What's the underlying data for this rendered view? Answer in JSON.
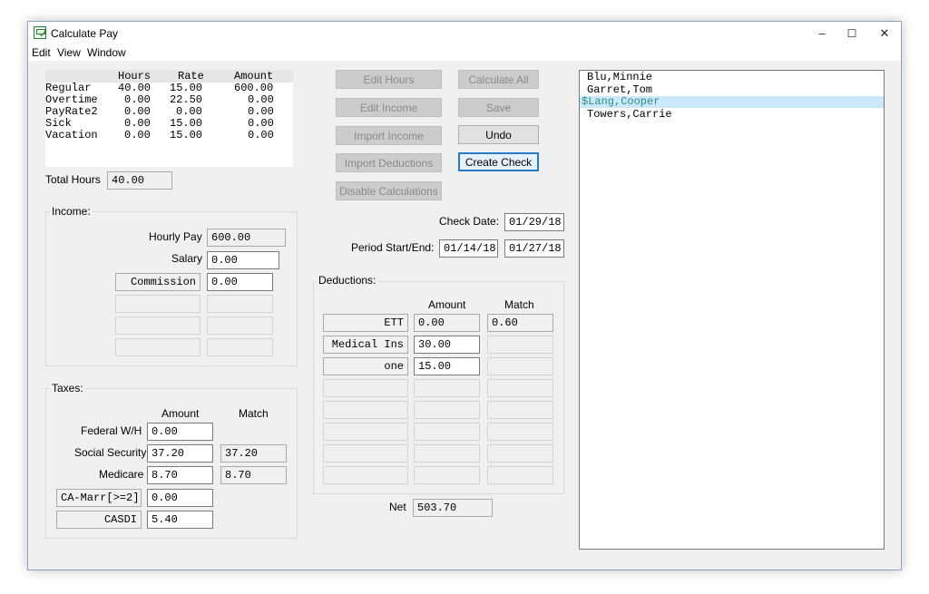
{
  "window": {
    "title": "Calculate Pay",
    "minimize": "–",
    "maximize": "☐",
    "close": "✕"
  },
  "menu": [
    "Edit",
    "View",
    "Window"
  ],
  "hours_table": {
    "headers": [
      "Hours",
      "Rate",
      "Amount"
    ],
    "rows": [
      {
        "label": "Regular",
        "hours": "40.00",
        "rate": "15.00",
        "amount": "600.00"
      },
      {
        "label": "Overtime",
        "hours": "0.00",
        "rate": "22.50",
        "amount": "0.00"
      },
      {
        "label": "PayRate2",
        "hours": "0.00",
        "rate": "0.00",
        "amount": "0.00"
      },
      {
        "label": "Sick",
        "hours": "0.00",
        "rate": "15.00",
        "amount": "0.00"
      },
      {
        "label": "Vacation",
        "hours": "0.00",
        "rate": "15.00",
        "amount": "0.00"
      }
    ]
  },
  "total_hours": {
    "label": "Total Hours",
    "value": "40.00"
  },
  "income": {
    "title": "Income:",
    "hourly_pay_label": "Hourly Pay",
    "hourly_pay_value": "600.00",
    "salary_label": "Salary",
    "salary_value": "0.00",
    "commission_label": "Commission",
    "commission_value": "0.00"
  },
  "taxes": {
    "title": "Taxes:",
    "amount_header": "Amount",
    "match_header": "Match",
    "federal_label": "Federal W/H",
    "federal_value": "0.00",
    "ss_label": "Social Security",
    "ss_value": "37.20",
    "ss_match": "37.20",
    "medicare_label": "Medicare",
    "medicare_value": "8.70",
    "medicare_match": "8.70",
    "state_label": "CA-Marr[>=2]",
    "state_value": "0.00",
    "casdi_label": "CASDI",
    "casdi_value": "5.40"
  },
  "buttons": {
    "edit_hours": "Edit Hours",
    "calculate_all": "Calculate All",
    "edit_income": "Edit Income",
    "save": "Save",
    "import_income": "Import Income",
    "undo": "Undo",
    "import_deductions": "Import Deductions",
    "create_check": "Create Check",
    "disable_calculations": "Disable Calculations"
  },
  "check_date": {
    "label": "Check Date:",
    "value": "01/29/18"
  },
  "period": {
    "label": "Period Start/End:",
    "start": "01/14/18",
    "end": "01/27/18"
  },
  "deductions": {
    "title": "Deductions:",
    "amount_header": "Amount",
    "match_header": "Match",
    "rows": [
      {
        "label": "ETT",
        "amount": "0.00",
        "match": "0.60"
      },
      {
        "label": "Medical Ins",
        "amount": "30.00",
        "match": ""
      },
      {
        "label": "one",
        "amount": "15.00",
        "match": ""
      }
    ]
  },
  "net": {
    "label": "Net",
    "value": "503.70"
  },
  "employees": [
    "Blu,Minnie",
    "Garret,Tom",
    "$Lang,Cooper",
    "Towers,Carrie"
  ],
  "selected_employee": 2
}
